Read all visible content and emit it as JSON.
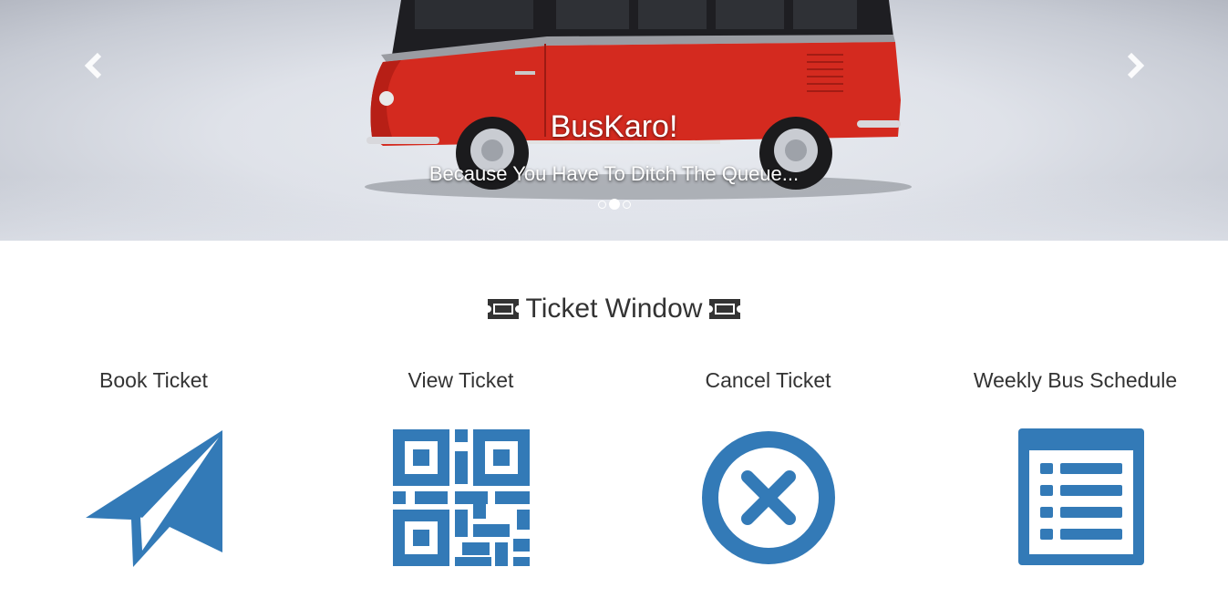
{
  "carousel": {
    "title": "BusKaro!",
    "subtitle": "Because You Have To Ditch The Queue...",
    "prev_icon": "chevron-left-icon",
    "next_icon": "chevron-right-icon",
    "indicators": 3,
    "active_indicator": 1
  },
  "section": {
    "title": "Ticket Window",
    "icon": "ticket-icon"
  },
  "cards": [
    {
      "label": "Book Ticket",
      "icon": "paper-plane-icon"
    },
    {
      "label": "View Ticket",
      "icon": "qrcode-icon"
    },
    {
      "label": "Cancel Ticket",
      "icon": "cancel-circle-icon"
    },
    {
      "label": "Weekly Bus Schedule",
      "icon": "list-icon"
    }
  ],
  "colors": {
    "accent": "#337ab7",
    "text": "#333333"
  }
}
